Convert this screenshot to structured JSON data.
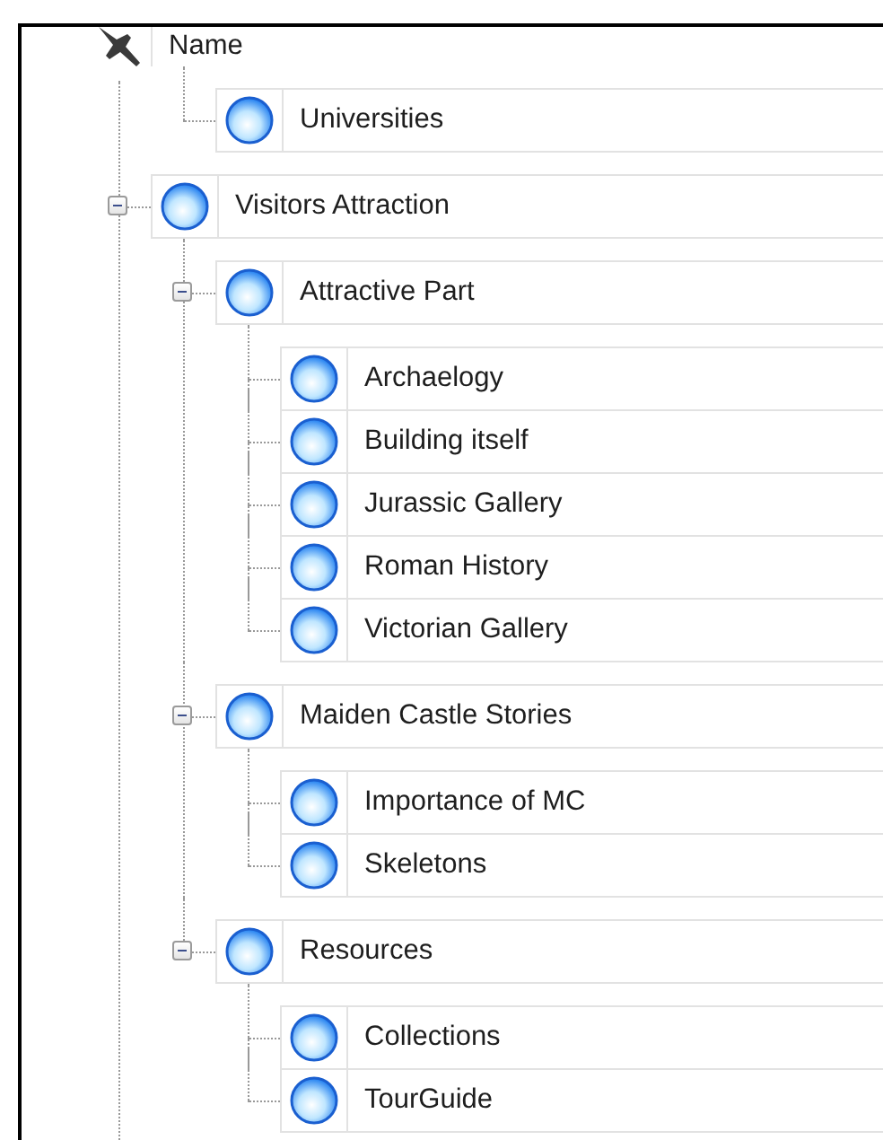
{
  "tree": [
    {
      "label": "Name",
      "kind": "pinned",
      "children": [
        {
          "label": "Universities"
        }
      ]
    },
    {
      "label": "Visitors Attraction",
      "expanded": true,
      "children": [
        {
          "label": "Attractive Part",
          "expanded": true,
          "children": [
            {
              "label": "Archaelogy"
            },
            {
              "label": "Building itself"
            },
            {
              "label": "Jurassic Gallery"
            },
            {
              "label": "Roman History"
            },
            {
              "label": "Victorian Gallery"
            }
          ]
        },
        {
          "label": "Maiden Castle Stories",
          "expanded": true,
          "children": [
            {
              "label": "Importance of MC"
            },
            {
              "label": "Skeletons"
            }
          ]
        },
        {
          "label": "Resources",
          "expanded": true,
          "children": [
            {
              "label": "Collections"
            },
            {
              "label": "TourGuide"
            }
          ]
        }
      ]
    }
  ]
}
